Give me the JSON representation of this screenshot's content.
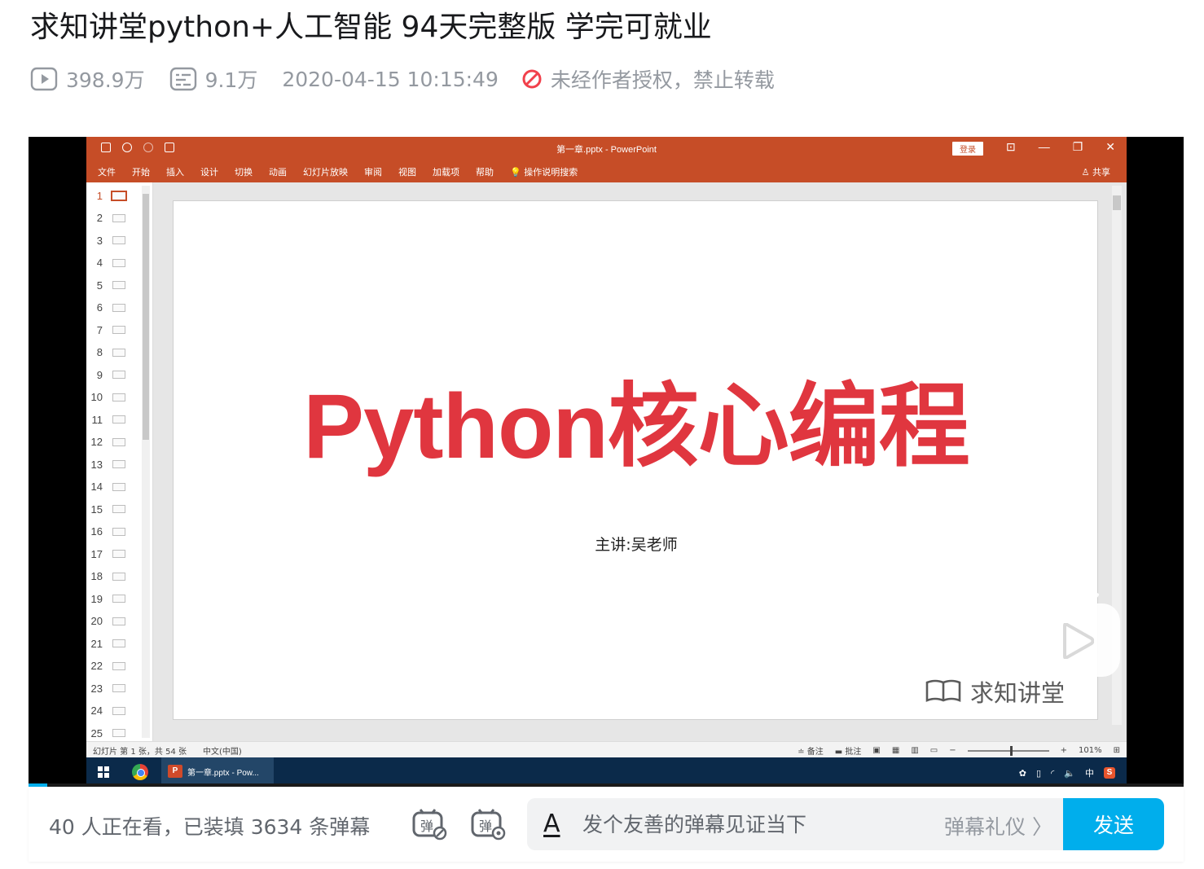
{
  "video": {
    "title": "求知讲堂python+人工智能 94天完整版 学完可就业",
    "views": "398.9万",
    "danmaku_count": "9.1万",
    "pubdate": "2020-04-15 10:15:49",
    "copyright": "未经作者授权，禁止转载"
  },
  "ppt": {
    "doc_title": "第一章.pptx  -  PowerPoint",
    "login": "登录",
    "window_controls": [
      "⊡",
      "—",
      "❐",
      "✕"
    ],
    "ribbon_tabs": [
      "文件",
      "开始",
      "插入",
      "设计",
      "切换",
      "动画",
      "幻灯片放映",
      "审阅",
      "视图",
      "加载项",
      "帮助",
      "💡 操作说明搜索"
    ],
    "share": "♙ 共享",
    "thumbnails": [
      "1",
      "2",
      "3",
      "4",
      "5",
      "6",
      "7",
      "8",
      "9",
      "10",
      "11",
      "12",
      "13",
      "14",
      "15",
      "16",
      "17",
      "18",
      "19",
      "20",
      "21",
      "22",
      "23",
      "24",
      "25"
    ],
    "slide_title": "Python核心编程",
    "slide_subtitle": "主讲:吴老师",
    "watermark": "求知讲堂",
    "status_slide": "幻灯片 第 1 张，共 54 张",
    "status_lang": "中文(中国)",
    "status_notes": "≐ 备注",
    "status_comments": "▬ 批注",
    "zoom_minus": "−",
    "zoom_plus": "+",
    "zoom": "101%"
  },
  "taskbar": {
    "app_icon": "P",
    "app_label": "第一章.pptx - Pow...",
    "ime": "中",
    "tray_s": "S"
  },
  "progress": 0.016,
  "player": {
    "viewers": "40 人正在看，已装填 3634 条弹幕",
    "danmaku_placeholder": "发个友善的弹幕见证当下",
    "input_icon": "A",
    "etiquette": "弹幕礼仪 〉",
    "send": "发送"
  },
  "colors": {
    "accent": "#00aeec",
    "ppt_orange": "#c64d27",
    "slide_title": "#e0363f",
    "copyright_red": "#f1404b"
  }
}
